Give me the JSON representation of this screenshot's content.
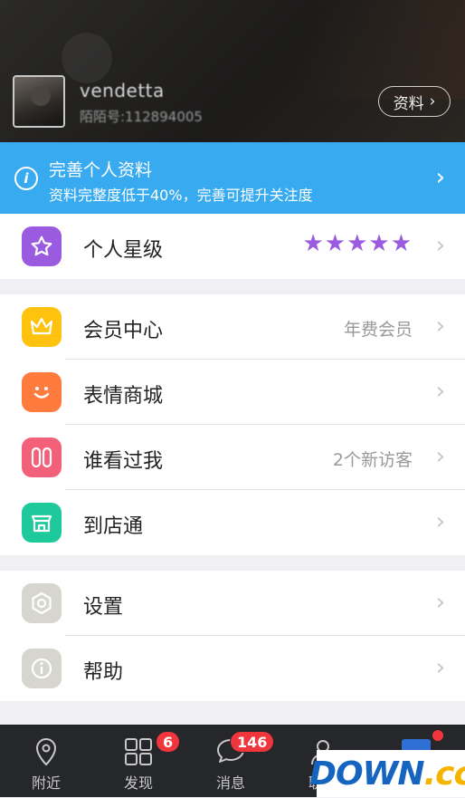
{
  "header": {
    "username": "vendetta",
    "account": "陌陌号:112894005",
    "profile_button": "资料"
  },
  "banner": {
    "title": "完善个人资料",
    "subtitle": "资料完整度低于40%，完善可提升关注度"
  },
  "menu": {
    "rating": {
      "label": "个人星级",
      "stars": "★★★★★",
      "star_count": 5
    },
    "member": {
      "label": "会员中心",
      "value": "年费会员"
    },
    "stickers": {
      "label": "表情商城"
    },
    "visitors": {
      "label": "谁看过我",
      "value": "2个新访客"
    },
    "store": {
      "label": "到店通"
    },
    "settings": {
      "label": "设置"
    },
    "help": {
      "label": "帮助"
    }
  },
  "tabbar": {
    "nearby": {
      "label": "附近"
    },
    "discover": {
      "label": "发现",
      "badge": "6"
    },
    "messages": {
      "label": "消息",
      "badge": "146"
    },
    "contacts": {
      "label": "联系"
    }
  },
  "watermark": {
    "text": "DOWN",
    "suffix": ".cc"
  },
  "colors": {
    "banner": "#37aaf0",
    "star": "#9b5be0",
    "member_icon": "#ffc20e",
    "stickers_icon": "#ff7a3d",
    "visitors_icon": "#f2607a",
    "store_icon": "#1ec99b",
    "settings_icon": "#d6d6cf",
    "badge": "#f0353c"
  }
}
